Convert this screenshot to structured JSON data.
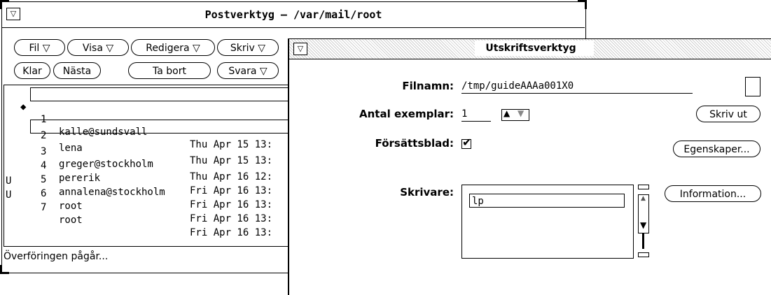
{
  "mail_window": {
    "title": "Postverktyg – /var/mail/root",
    "menu_glyph": "▽",
    "buttons_row1": [
      {
        "label": "Fil ▽"
      },
      {
        "label": "Visa ▽"
      },
      {
        "label": "Redigera ▽"
      },
      {
        "label": "Skriv  ▽"
      }
    ],
    "buttons_row2": [
      {
        "label": "Klar"
      },
      {
        "label": "Nästa"
      },
      {
        "label": "Ta bort"
      },
      {
        "label": "Svara ▽"
      }
    ],
    "messages": [
      {
        "flag": "◆",
        "num": "1",
        "from": "kalle@sundsvall",
        "date": "Thu Apr 15 13:"
      },
      {
        "flag": "",
        "num": "2",
        "from": "lena",
        "date": "Thu Apr 15 13:"
      },
      {
        "flag": "",
        "num": "3",
        "from": "greger@stockholm",
        "date": "Thu Apr 16 12:"
      },
      {
        "flag": "",
        "num": "4",
        "from": "pererik",
        "date": "Fri Apr 16 13:"
      },
      {
        "flag": "",
        "num": "5",
        "from": "annalena@stockholm",
        "date": "Fri Apr 16 13:"
      },
      {
        "flag": "U",
        "num": "6",
        "from": "root",
        "date": "Fri Apr 16 13:"
      },
      {
        "flag": "U",
        "num": "7",
        "from": "root",
        "date": "Fri Apr 16 13:"
      }
    ],
    "status": "Överföringen pågår..."
  },
  "print_window": {
    "title": "Utskriftsverktyg",
    "menu_glyph": "▽",
    "filename_label": "Filnamn:",
    "filename_value": "/tmp/guideAAAa001X0",
    "copies_label": "Antal exemplar:",
    "copies_value": "1",
    "cover_label": "Försättsblad:",
    "cover_checked": "✔",
    "printer_label": "Skrivare:",
    "printer_value": "lp",
    "print_button": "Skriv ut",
    "properties_button": "Egenskaper...",
    "info_button": "Information..."
  }
}
